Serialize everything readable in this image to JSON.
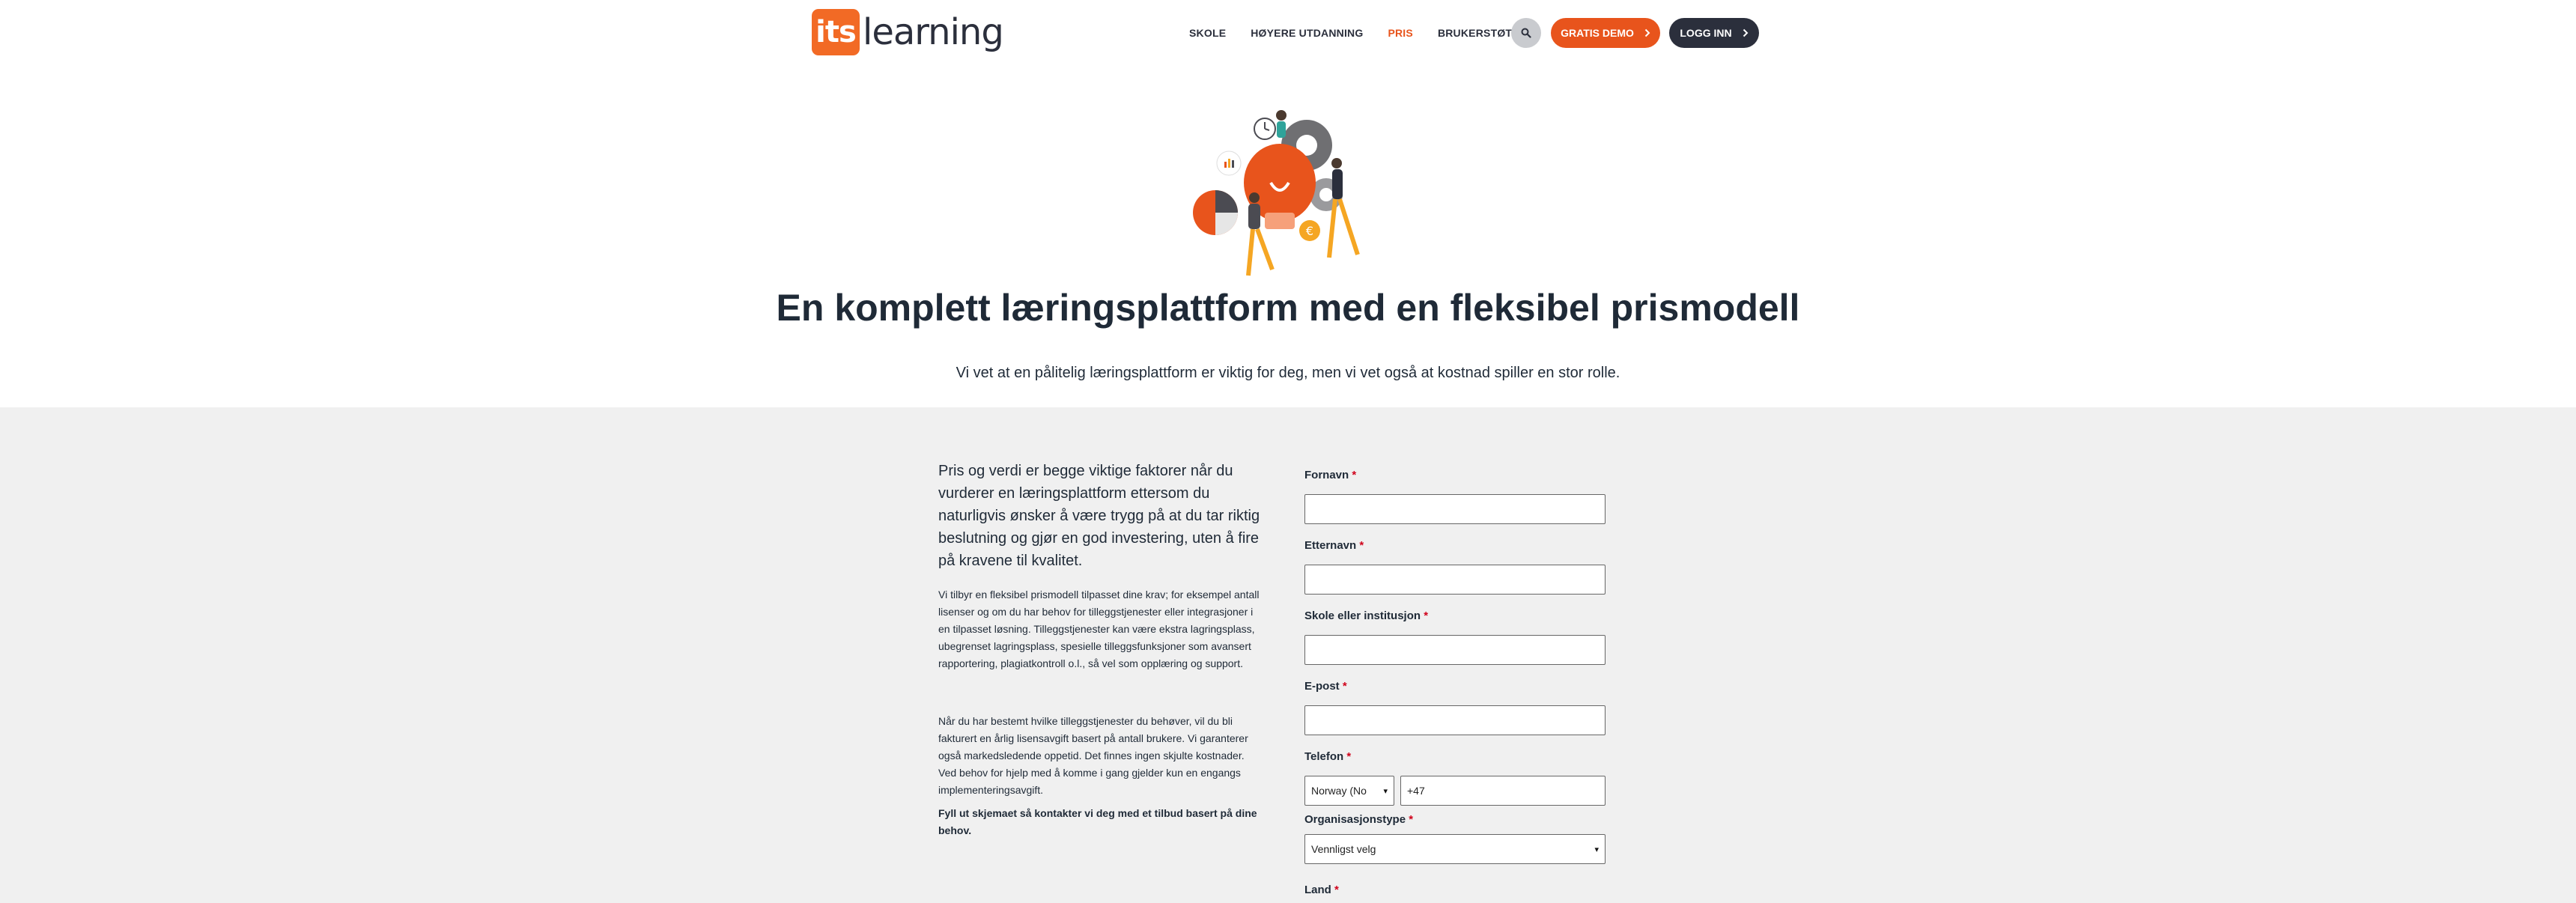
{
  "header": {
    "logo_its": "its",
    "logo_text": "learning",
    "nav": [
      {
        "label": "SKOLE",
        "active": false
      },
      {
        "label": "HØYERE UTDANNING",
        "active": false
      },
      {
        "label": "PRIS",
        "active": true
      },
      {
        "label": "BRUKERSTØTTE",
        "active": false
      }
    ],
    "search_icon": "search-icon",
    "demo_label": "GRATIS DEMO",
    "login_label": "LOGG INN"
  },
  "hero": {
    "title": "En komplett læringsplattform med en fleksibel prismodell",
    "subtitle": "Vi vet at en pålitelig læringsplattform er viktig for deg, men vi vet også at kostnad spiller en stor rolle."
  },
  "content": {
    "intro": "Pris og verdi er begge viktige faktorer når du vurderer en læringsplattform ettersom du naturligvis ønsker å være trygg på at du tar riktig beslutning og gjør en god investering, uten å fire på kravene til kvalitet.",
    "p1": "Vi tilbyr en fleksibel prismodell tilpasset dine krav; for eksempel antall lisenser og om du har behov for tilleggstjenester eller integrasjoner i en tilpasset løsning. Tilleggstjenester kan være ekstra lagringsplass, ubegrenset lagringsplass, spesielle tilleggsfunksjoner som avansert rapportering, plagiatkontroll o.l., så vel som opplæring og support.",
    "p2": "Når du har bestemt hvilke tilleggstjenester du behøver, vil du bli fakturert en årlig lisensavgift basert på antall brukere. Vi garanterer også markedsledende oppetid. Det finnes ingen skjulte kostnader. Ved behov for hjelp med å komme i gang gjelder kun en engangs implementeringsavgift.",
    "p3": "Fyll ut skjemaet så kontakter vi deg med et tilbud basert på dine behov."
  },
  "form": {
    "required_mark": "*",
    "first_name_label": "Fornavn",
    "last_name_label": "Etternavn",
    "school_label": "Skole eller institusjon",
    "email_label": "E-post",
    "phone_label": "Telefon",
    "country_code_value": "Norway (No",
    "phone_value": "+47",
    "org_type_label": "Organisasjonstype",
    "org_type_value": "Vennligst velg",
    "country_label": "Land"
  },
  "colors": {
    "accent": "#e8541c",
    "dark": "#2b2f3c",
    "section_bg": "#f0f0f0"
  }
}
